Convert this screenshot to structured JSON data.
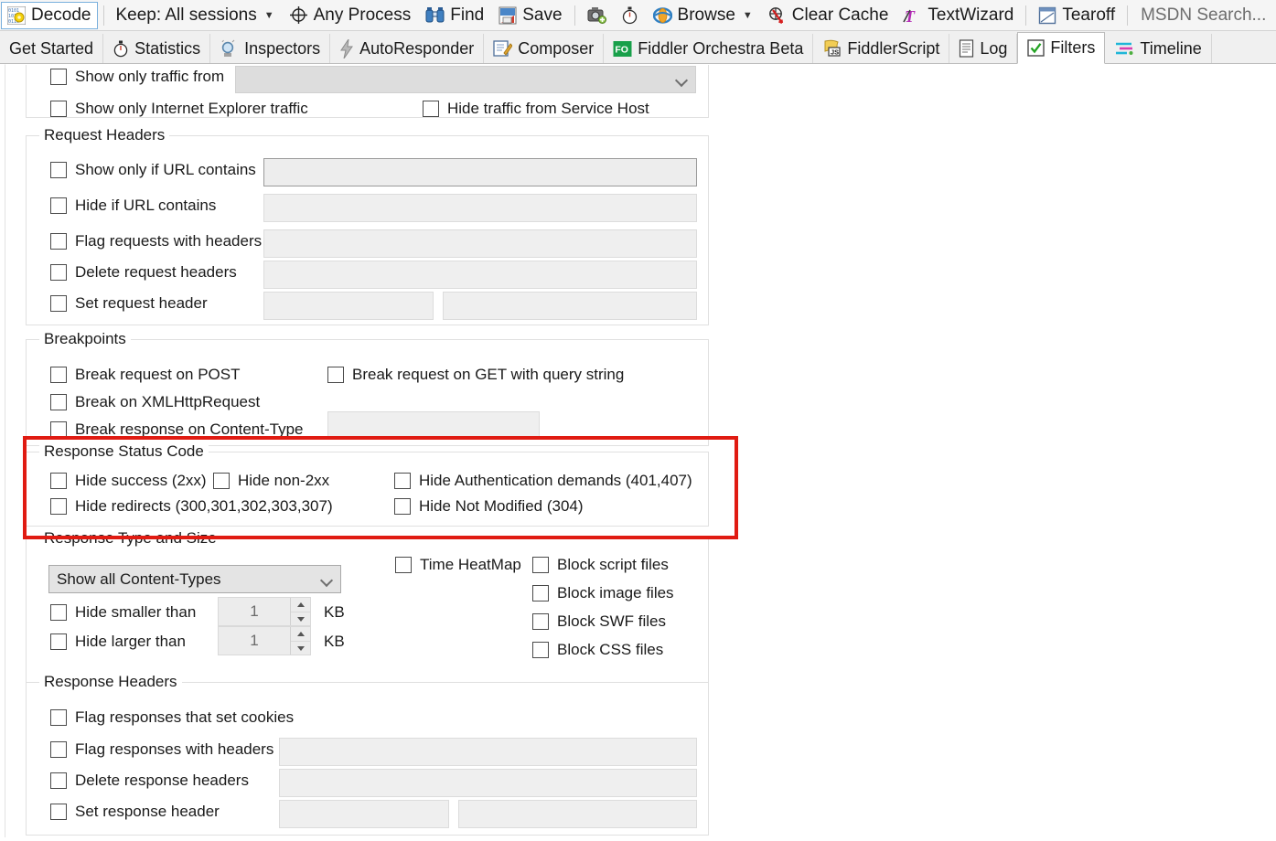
{
  "toolbar": {
    "items": [
      {
        "name": "decode-button",
        "label": "Decode",
        "icon": "decode-icon",
        "selected": true
      },
      {
        "name": "keep-sessions-dropdown",
        "label": "Keep: All sessions",
        "icon": "none",
        "caret": true
      },
      {
        "name": "any-process-button",
        "label": "Any Process",
        "icon": "target-icon"
      },
      {
        "name": "find-button",
        "label": "Find",
        "icon": "binoculars-icon"
      },
      {
        "name": "save-button",
        "label": "Save",
        "icon": "save-icon"
      },
      {
        "name": "screenshot-button",
        "label": "",
        "icon": "camera-icon"
      },
      {
        "name": "timer-button",
        "label": "",
        "icon": "stopwatch-icon"
      },
      {
        "name": "browse-button",
        "label": "Browse",
        "icon": "browser-icon",
        "caret": true
      },
      {
        "name": "clear-cache-button",
        "label": "Clear Cache",
        "icon": "clear-cache-icon"
      },
      {
        "name": "textwizard-button",
        "label": "TextWizard",
        "icon": "textwizard-icon"
      },
      {
        "name": "tearoff-button",
        "label": "Tearoff",
        "icon": "tearoff-icon"
      }
    ],
    "search_placeholder": "MSDN Search..."
  },
  "tabs": [
    {
      "name": "tab-get-started",
      "label": "Get Started",
      "icon": "none",
      "active": false
    },
    {
      "name": "tab-statistics",
      "label": "Statistics",
      "icon": "stopwatch-icon",
      "active": false
    },
    {
      "name": "tab-inspectors",
      "label": "Inspectors",
      "icon": "magnifier-icon",
      "active": false
    },
    {
      "name": "tab-autoresponder",
      "label": "AutoResponder",
      "icon": "bolt-icon",
      "active": false
    },
    {
      "name": "tab-composer",
      "label": "Composer",
      "icon": "compose-icon",
      "active": false
    },
    {
      "name": "tab-fiddler-orchestra-beta",
      "label": "Fiddler Orchestra Beta",
      "icon": "fo-icon",
      "active": false
    },
    {
      "name": "tab-fiddlerscript",
      "label": "FiddlerScript",
      "icon": "js-icon",
      "active": false
    },
    {
      "name": "tab-log",
      "label": "Log",
      "icon": "log-icon",
      "active": false
    },
    {
      "name": "tab-filters",
      "label": "Filters",
      "icon": "checkbox-green-icon",
      "active": true
    },
    {
      "name": "tab-timeline",
      "label": "Timeline",
      "icon": "timeline-icon",
      "active": false
    }
  ],
  "hosts_group": {
    "show_only_traffic_from": {
      "label": "Show only traffic from",
      "checked": false,
      "value": ""
    },
    "show_only_ie_traffic": {
      "label": "Show only Internet Explorer traffic",
      "checked": false
    },
    "hide_service_host": {
      "label": "Hide traffic from Service Host",
      "checked": false
    }
  },
  "request_headers": {
    "title": "Request Headers",
    "rows": [
      {
        "name": "show-only-if-url-contains",
        "label": "Show only if URL contains",
        "checked": false,
        "value": "",
        "field": "wide-strong"
      },
      {
        "name": "hide-if-url-contains",
        "label": "Hide if URL contains",
        "checked": false,
        "value": "",
        "field": "wide"
      },
      {
        "name": "flag-requests-with-headers",
        "label": "Flag requests with headers",
        "checked": false,
        "value": "",
        "field": "wide"
      },
      {
        "name": "delete-request-headers",
        "label": "Delete request headers",
        "checked": false,
        "value": "",
        "field": "wide"
      },
      {
        "name": "set-request-header",
        "label": "Set request header",
        "checked": false,
        "value": "",
        "value2": "",
        "field": "split"
      }
    ]
  },
  "breakpoints": {
    "title": "Breakpoints",
    "break_request_on_post": {
      "label": "Break request on POST",
      "checked": false
    },
    "break_request_on_get": {
      "label": "Break request on GET with query string",
      "checked": false
    },
    "break_on_xhr": {
      "label": "Break on XMLHttpRequest",
      "checked": false
    },
    "break_response_on_content_type": {
      "label": "Break response on Content-Type",
      "checked": false,
      "value": ""
    }
  },
  "response_status_code": {
    "title": "Response Status Code",
    "highlighted": true,
    "highlight_color": "#e01b12",
    "hide_success": {
      "label": "Hide success (2xx)",
      "checked": false
    },
    "hide_non_2xx": {
      "label": "Hide non-2xx",
      "checked": false
    },
    "hide_auth_demands": {
      "label": "Hide Authentication demands (401,407)",
      "checked": false
    },
    "hide_redirects": {
      "label": "Hide redirects (300,301,302,303,307)",
      "checked": false
    },
    "hide_not_modified": {
      "label": "Hide Not Modified (304)",
      "checked": false
    }
  },
  "response_type_size": {
    "title": "Response Type and Size",
    "content_type_select": {
      "label": "Show all Content-Types",
      "options": [
        "Show all Content-Types"
      ]
    },
    "hide_smaller_than": {
      "label": "Hide smaller than",
      "checked": false,
      "value": "1",
      "unit": "KB"
    },
    "hide_larger_than": {
      "label": "Hide larger than",
      "checked": false,
      "value": "1",
      "unit": "KB"
    },
    "time_heatmap": {
      "label": "Time HeatMap",
      "checked": false
    },
    "blocks": [
      {
        "name": "block-script-files",
        "label": "Block script files",
        "checked": false
      },
      {
        "name": "block-image-files",
        "label": "Block image files",
        "checked": false
      },
      {
        "name": "block-swf-files",
        "label": "Block SWF files",
        "checked": false
      },
      {
        "name": "block-css-files",
        "label": "Block CSS files",
        "checked": false
      }
    ]
  },
  "response_headers": {
    "title": "Response Headers",
    "rows": [
      {
        "name": "flag-responses-that-set-cookies",
        "label": "Flag responses that set cookies",
        "checked": false,
        "field": "none"
      },
      {
        "name": "flag-responses-with-headers",
        "label": "Flag responses with headers",
        "checked": false,
        "value": "",
        "field": "wide"
      },
      {
        "name": "delete-response-headers",
        "label": "Delete response headers",
        "checked": false,
        "value": "",
        "field": "wide"
      },
      {
        "name": "set-response-header",
        "label": "Set response header",
        "checked": false,
        "value": "",
        "value2": "",
        "field": "split"
      }
    ]
  }
}
